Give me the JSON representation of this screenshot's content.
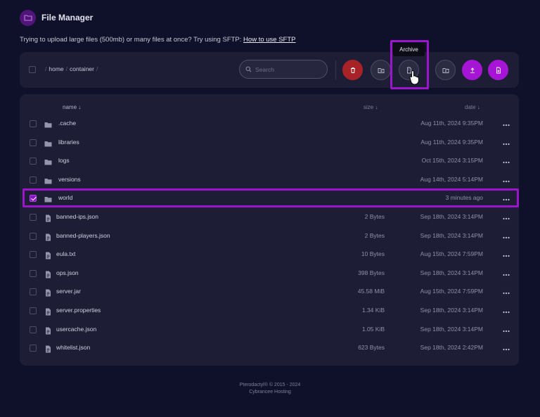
{
  "app": {
    "title": "File Manager"
  },
  "notice": {
    "text": "Trying to upload large files (500mb) or many files at once? Try using SFTP: ",
    "link": "How to use SFTP"
  },
  "breadcrumb": {
    "items": [
      "home",
      "container"
    ]
  },
  "search": {
    "placeholder": "Search"
  },
  "toolbar": {
    "buttons": [
      "delete-button",
      "move-button",
      "archive-button",
      "new-folder-button",
      "upload-button",
      "new-file-button"
    ],
    "tooltip": "Archive",
    "colors": {
      "delete": "#a82327",
      "primary": "#a614d6",
      "highlight": "#9b15cc"
    }
  },
  "table": {
    "columns": {
      "name": "name ↓",
      "size": "size ↓",
      "date": "date ↓"
    },
    "rows": [
      {
        "type": "folder",
        "name": ".cache",
        "size": "",
        "date": "Aug 11th, 2024 9:35PM",
        "checked": false
      },
      {
        "type": "folder",
        "name": "libraries",
        "size": "",
        "date": "Aug 11th, 2024 9:35PM",
        "checked": false
      },
      {
        "type": "folder",
        "name": "logs",
        "size": "",
        "date": "Oct 15th, 2024 3:15PM",
        "checked": false
      },
      {
        "type": "folder",
        "name": "versions",
        "size": "",
        "date": "Aug 14th, 2024 5:14PM",
        "checked": false
      },
      {
        "type": "folder",
        "name": "world",
        "size": "",
        "date": "3 minutes ago",
        "checked": true
      },
      {
        "type": "file",
        "name": "banned-ips.json",
        "size": "2 Bytes",
        "date": "Sep 18th, 2024 3:14PM",
        "checked": false
      },
      {
        "type": "file",
        "name": "banned-players.json",
        "size": "2 Bytes",
        "date": "Sep 18th, 2024 3:14PM",
        "checked": false
      },
      {
        "type": "file",
        "name": "eula.txt",
        "size": "10 Bytes",
        "date": "Aug 15th, 2024 7:59PM",
        "checked": false
      },
      {
        "type": "file",
        "name": "ops.json",
        "size": "398 Bytes",
        "date": "Sep 18th, 2024 3:14PM",
        "checked": false
      },
      {
        "type": "file",
        "name": "server.jar",
        "size": "45.58 MiB",
        "date": "Aug 15th, 2024 7:59PM",
        "checked": false
      },
      {
        "type": "file",
        "name": "server.properties",
        "size": "1.34 KiB",
        "date": "Sep 18th, 2024 3:14PM",
        "checked": false
      },
      {
        "type": "file",
        "name": "usercache.json",
        "size": "1.05 KiB",
        "date": "Sep 18th, 2024 3:14PM",
        "checked": false
      },
      {
        "type": "file",
        "name": "whitelist.json",
        "size": "623 Bytes",
        "date": "Sep 18th, 2024 2:42PM",
        "checked": false
      }
    ]
  },
  "footer": {
    "line1": "Pterodactyl® © 2015 - 2024",
    "line2": "Cybrancee Hosting"
  }
}
